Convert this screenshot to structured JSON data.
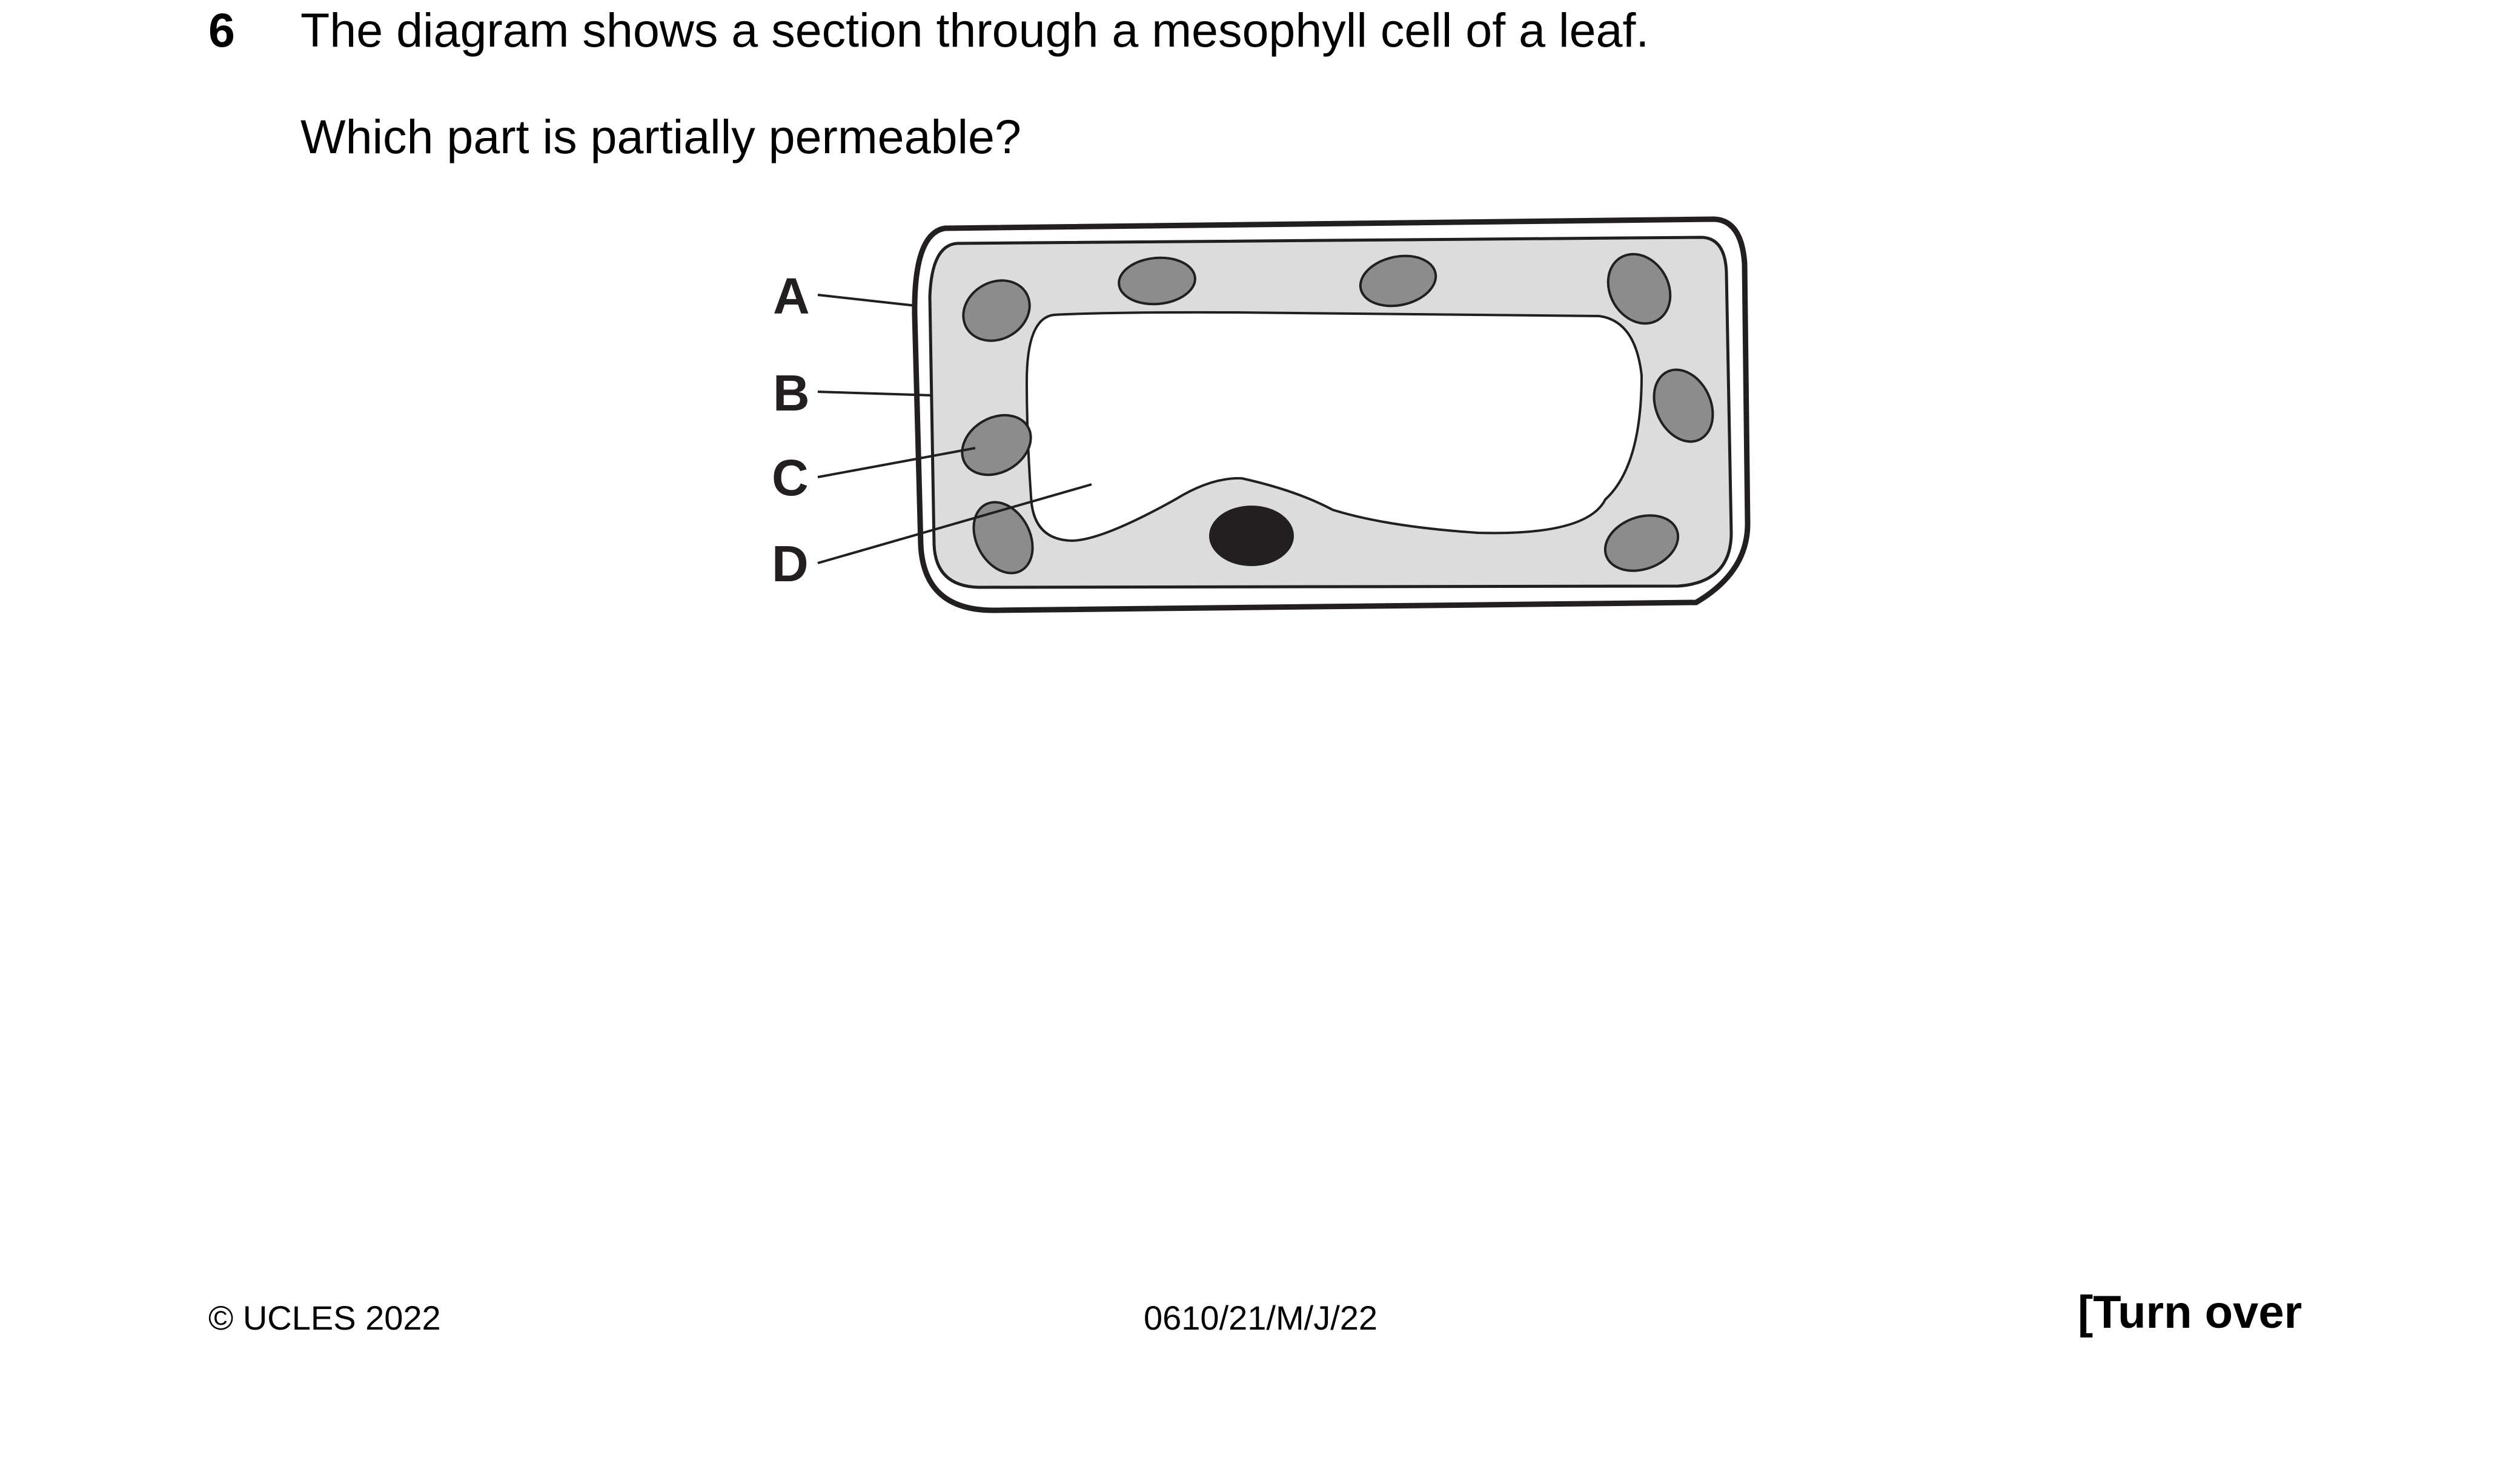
{
  "question": {
    "number": "6",
    "stem": "The diagram shows a section through a mesophyll cell of a leaf.",
    "prompt": "Which part is partially permeable?"
  },
  "diagram": {
    "labels": {
      "a": "A",
      "b": "B",
      "c": "C",
      "d": "D"
    },
    "colors": {
      "outline": "#231f20",
      "cytoplasm": "#dcdcdc",
      "chloroplast": "#8c8c8c",
      "nucleus": "#231f20",
      "vacuole": "#ffffff"
    }
  },
  "footer": {
    "copyright": "© UCLES 2022",
    "code": "0610/21/M/J/22",
    "turn_over": "[Turn over"
  }
}
